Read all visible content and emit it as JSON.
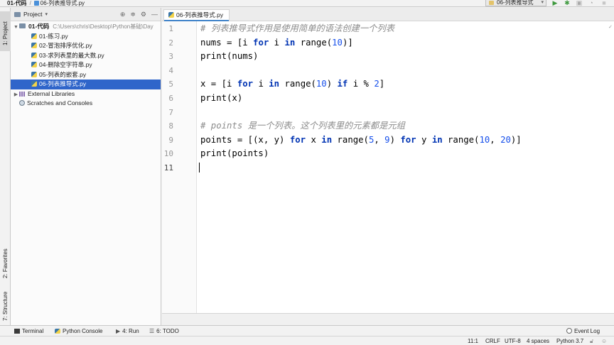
{
  "navbar": {
    "project": "01-代码",
    "file": "06-列表推导式.py"
  },
  "toolbar": {
    "run_config": "06-列表推导式",
    "icons": [
      "run-icon",
      "debug-icon",
      "coverage-icon",
      "profile-icon",
      "stop-icon"
    ]
  },
  "left_strip": {
    "project_tab": "1: Project",
    "favorites_tab": "2: Favorites",
    "structure_tab": "7: Structure"
  },
  "project_panel": {
    "title": "Project",
    "root": {
      "name": "01-代码",
      "path": "C:\\Users\\chris\\Desktop\\Python基础\\Day"
    },
    "files": [
      "01-练习.py",
      "02-冒泡排序优化.py",
      "03-求列表里的最大数.py",
      "04-删除空字符串.py",
      "05-列表的嵌套.py",
      "06-列表推导式.py"
    ],
    "selected_file_index": 5,
    "external_libraries": "External Libraries",
    "scratches": "Scratches and Consoles"
  },
  "editor": {
    "tab_label": "06-列表推导式.py",
    "line_numbers": [
      "1",
      "2",
      "3",
      "4",
      "5",
      "6",
      "7",
      "8",
      "9",
      "10",
      "11"
    ],
    "current_line": 11
  },
  "bottom_tools": {
    "terminal": "Terminal",
    "python_console": "Python Console",
    "run": "4: Run",
    "todo": "6: TODO",
    "event_log": "Event Log"
  },
  "statusbar": {
    "position": "11:1",
    "line_sep": "CRLF",
    "encoding": "UTF-8",
    "indent": "4 spaces",
    "interpreter": "Python 3.7"
  }
}
